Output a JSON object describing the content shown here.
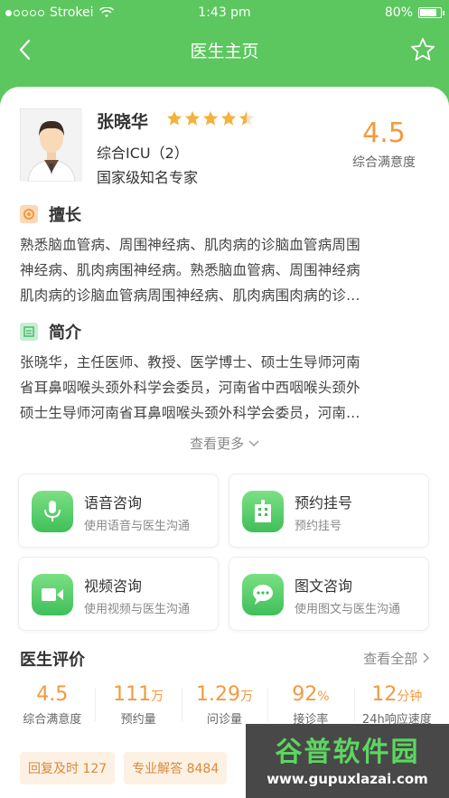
{
  "status_bar": {
    "carrier": "Strokei",
    "time": "1:43 pm",
    "battery": "80%"
  },
  "navbar": {
    "title": "医生主页"
  },
  "doctor": {
    "name": "张晓华",
    "rating": 4.5,
    "department": "综合ICU（2）",
    "title": "国家级知名专家",
    "score": "4.5",
    "score_label": "综合满意度"
  },
  "specialty": {
    "heading": "擅长",
    "lines": [
      "熟悉脑血管病、周围神经病、肌肉病的诊脑血管病周围",
      "神经病、肌肉病围神经病。熟悉脑血管病、周围神经病",
      "肌肉病的诊脑血管病周围神经病、肌肉病围肉病的诊..."
    ]
  },
  "intro": {
    "heading": "简介",
    "lines": [
      "张晓华，主任医师、教授、医学博士、硕士生导师河南",
      "省耳鼻咽喉头颈外科学会委员，河南省中西咽喉头颈外",
      "硕士生导师河南省耳鼻咽喉头颈外科学会委员，河南..."
    ]
  },
  "more_label": "查看更多",
  "services": [
    {
      "title": "语音咨询",
      "subtitle": "使用语音与医生沟通",
      "icon": "microphone-icon"
    },
    {
      "title": "预约挂号",
      "subtitle": "预约挂号",
      "icon": "hospital-icon"
    },
    {
      "title": "视频咨询",
      "subtitle": "使用视频与医生沟通",
      "icon": "video-icon"
    },
    {
      "title": "图文咨询",
      "subtitle": "使用图文与医生沟通",
      "icon": "chat-icon"
    }
  ],
  "evaluation": {
    "heading": "医生评价",
    "view_all": "查看全部",
    "stats": [
      {
        "value": "4.5",
        "unit": "",
        "label": "综合满意度"
      },
      {
        "value": "111",
        "unit": "万",
        "label": "预约量"
      },
      {
        "value": "1.29",
        "unit": "万",
        "label": "问诊量"
      },
      {
        "value": "92",
        "unit": "%",
        "label": "接诊率"
      },
      {
        "value": "12",
        "unit": "分钟",
        "label": "24h响应速度"
      }
    ],
    "tags": [
      "回复及时 127",
      "专业解答 8484"
    ]
  },
  "watermark": {
    "top": "谷普软件园",
    "bottom": "www.gupuxlazai.com"
  },
  "colors": {
    "brand": "#5cc75f",
    "accent": "#f29a3f"
  }
}
